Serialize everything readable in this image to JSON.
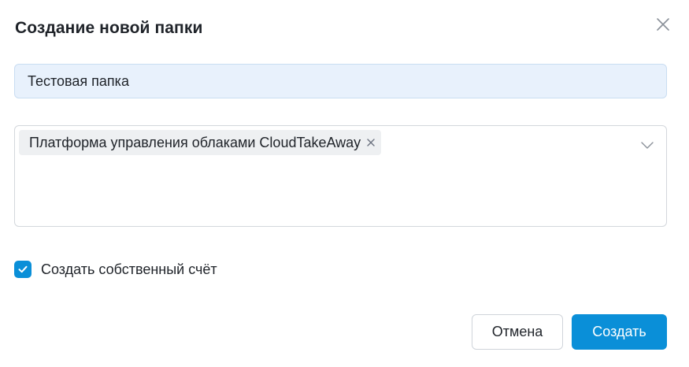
{
  "dialog": {
    "title": "Создание новой папки"
  },
  "name_field": {
    "value": "Тестовая папка"
  },
  "service_select": {
    "selected_chip": "Платформа управления облаками CloudTakeAway"
  },
  "own_account_checkbox": {
    "label": "Создать собственный счёт",
    "checked": true
  },
  "footer": {
    "cancel_label": "Отмена",
    "create_label": "Создать"
  },
  "colors": {
    "accent": "#0a8fd8",
    "input_background": "#e8f1fc",
    "chip_background": "#eef0f2"
  },
  "icons": {
    "close": "close-icon",
    "chip_remove": "close-small-icon",
    "dropdown": "chevron-down-icon",
    "checkbox": "checkmark-icon"
  }
}
